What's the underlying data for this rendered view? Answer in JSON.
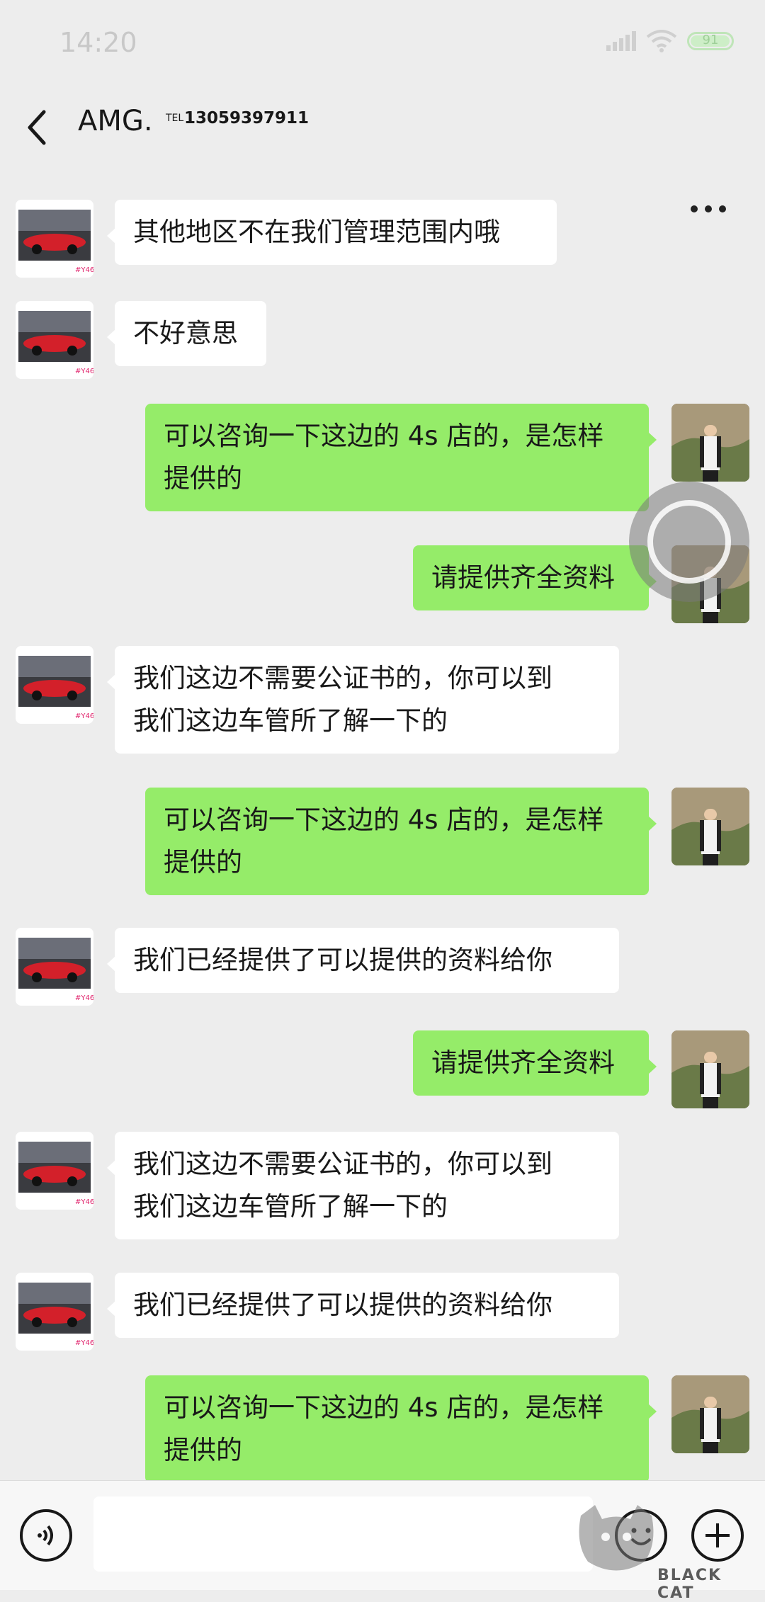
{
  "status_bar": {
    "time": "14:20",
    "battery": "91"
  },
  "header": {
    "name": "AMG.",
    "tel_label": "TEL",
    "tel_number": "13059397911"
  },
  "messages": [
    {
      "side": "in",
      "text": "其他地区不在我们管理范围内哦"
    },
    {
      "side": "in",
      "text": "不好意思"
    },
    {
      "side": "out",
      "line1": "可以咨询一下这边的 4s 店的，是怎样",
      "line2": "提供的"
    },
    {
      "side": "out",
      "text": "请提供齐全资料"
    },
    {
      "side": "in",
      "line1": "我们这边不需要公证书的，你可以到",
      "line2": "我们这边车管所了解一下的"
    },
    {
      "side": "out",
      "line1": "可以咨询一下这边的 4s 店的，是怎样",
      "line2": "提供的"
    },
    {
      "side": "in",
      "text": "我们已经提供了可以提供的资料给你"
    },
    {
      "side": "out",
      "text": "请提供齐全资料"
    },
    {
      "side": "in",
      "line1": "我们这边不需要公证书的，你可以到",
      "line2": "我们这边车管所了解一下的"
    },
    {
      "side": "in",
      "text": "我们已经提供了可以提供的资料给你"
    },
    {
      "side": "out",
      "line1": "可以咨询一下这边的 4s 店的，是怎样",
      "line2": "提供的"
    }
  ],
  "watermark": {
    "label": "BLACK CAT"
  },
  "icons": {
    "back": "chevron-left-icon",
    "more": "more-dots-icon",
    "voice": "voice-icon",
    "emoji": "emoji-icon",
    "add": "plus-icon"
  },
  "colors": {
    "outgoing": "#95ec69",
    "incoming": "#ffffff",
    "background": "#ededed"
  }
}
